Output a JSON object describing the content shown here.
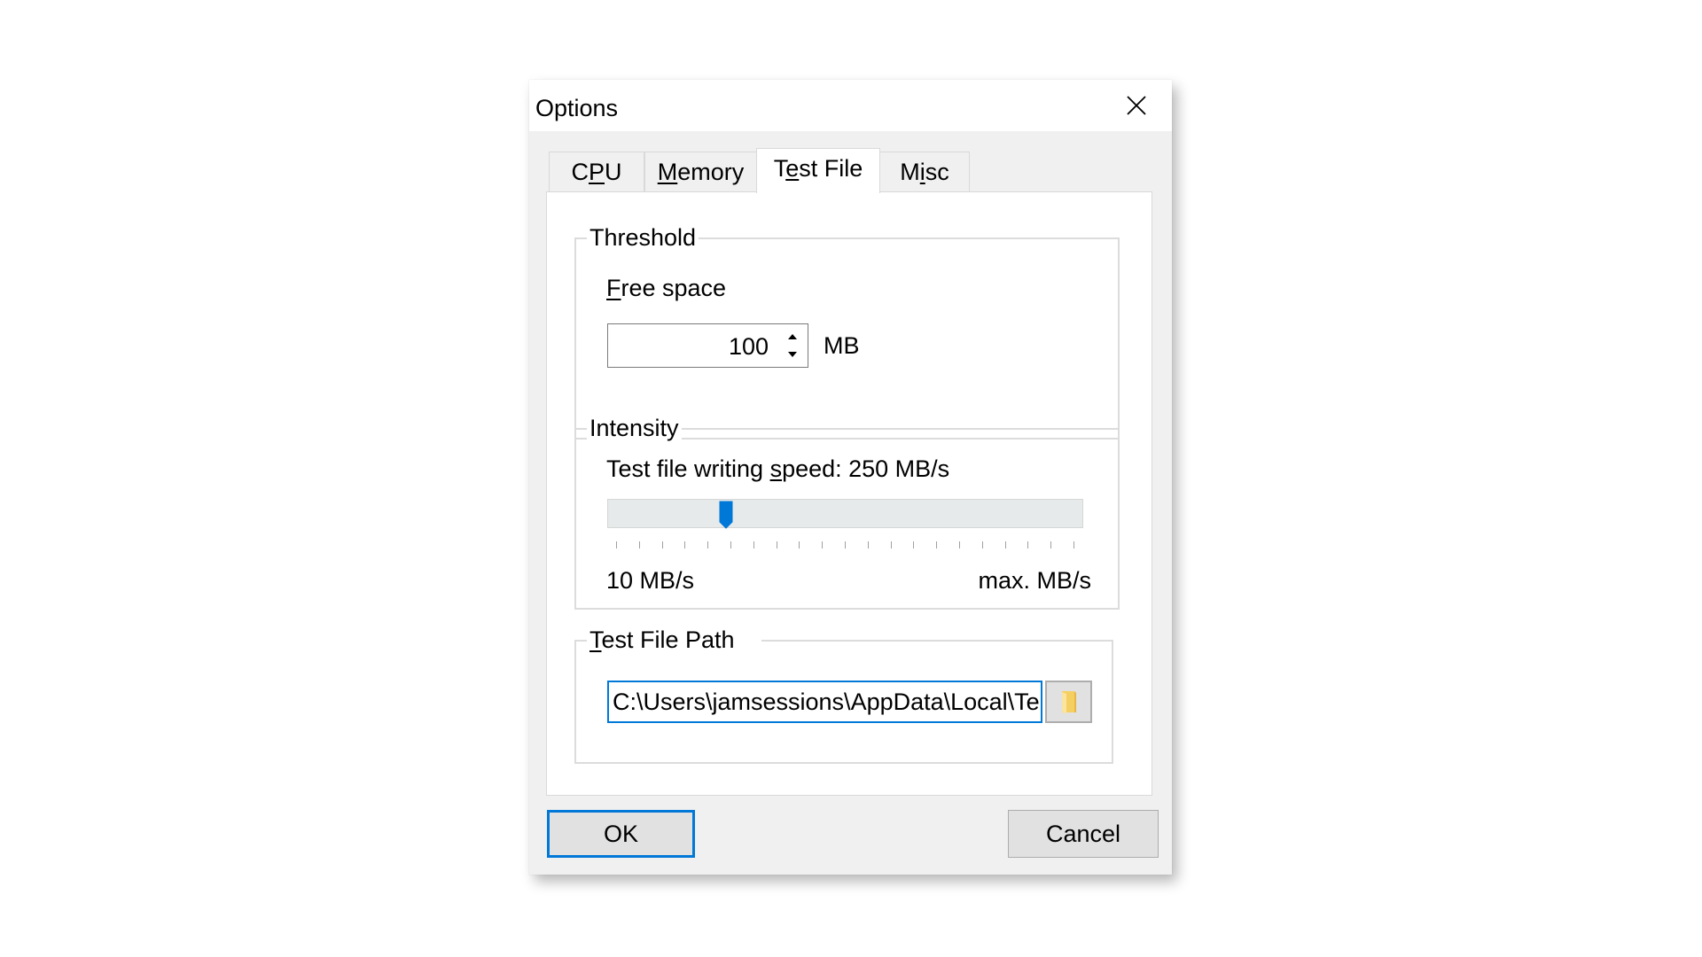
{
  "window": {
    "title": "Options",
    "close_icon": "close-icon"
  },
  "tabs": [
    {
      "label_pre": "C",
      "label_u": "P",
      "label_post": "U",
      "active": false
    },
    {
      "label_pre": "",
      "label_u": "M",
      "label_post": "emory",
      "active": false
    },
    {
      "label_pre": "T",
      "label_u": "e",
      "label_post": "st File",
      "active": true
    },
    {
      "label_pre": "M",
      "label_u": "i",
      "label_post": "sc",
      "active": false
    }
  ],
  "threshold": {
    "group_label": "Threshold",
    "free_space_label_u": "F",
    "free_space_label_rest": "ree space",
    "value": "100",
    "unit": "MB",
    "up_icon": "spin-up-arrow-icon",
    "down_icon": "spin-down-arrow-icon"
  },
  "intensity": {
    "group_label": "Intensity",
    "speed_label_pre": "Test file writing ",
    "speed_label_u": "s",
    "speed_label_post": "peed: 250 MB/s",
    "slider_fraction": 0.24,
    "tick_count": 21,
    "min_label": "10 MB/s",
    "max_label": "max. MB/s",
    "accent_color": "#0078d7"
  },
  "test_file_path": {
    "group_label_u": "T",
    "group_label_rest": "est File Path",
    "value": "C:\\Users\\jamsessions\\AppData\\Local\\Te",
    "browse_icon": "folder-icon"
  },
  "buttons": {
    "ok": "OK",
    "cancel": "Cancel"
  }
}
